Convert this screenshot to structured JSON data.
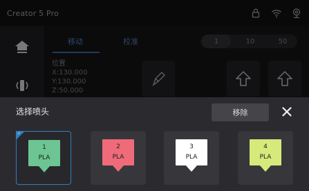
{
  "app": {
    "title": "Creator 5 Pro"
  },
  "tabs": [
    {
      "label": "移动"
    },
    {
      "label": "校准"
    }
  ],
  "steps": [
    {
      "label": "1"
    },
    {
      "label": "10"
    },
    {
      "label": "50"
    }
  ],
  "position": {
    "heading": "位置",
    "x": "X:130.000",
    "y": "Y:130.000",
    "z": "Z:50.000"
  },
  "icons": {
    "status": [
      "lock-icon",
      "wifi-icon",
      "webcam-icon"
    ],
    "sidebar": [
      "home-icon",
      "vibration-icon"
    ],
    "jog": [
      "home-xy-icon",
      "arrow-up-icon",
      "arrow-up-icon"
    ]
  },
  "dialog": {
    "title": "选择喷头",
    "remove_label": "移除",
    "nozzles": [
      {
        "number": "1",
        "material": "PLA",
        "color": "#6cc592",
        "selected": true
      },
      {
        "number": "2",
        "material": "PLA",
        "color": "#ef6b7a",
        "selected": false
      },
      {
        "number": "3",
        "material": "PLA",
        "color": "#ffffff",
        "selected": false
      },
      {
        "number": "4",
        "material": "PLA",
        "color": "#d6ea7b",
        "selected": false
      }
    ]
  },
  "colors": {
    "accent": "#2f7ec2",
    "dialog_bg": "#2b2b2f",
    "card_bg": "#37373b"
  }
}
